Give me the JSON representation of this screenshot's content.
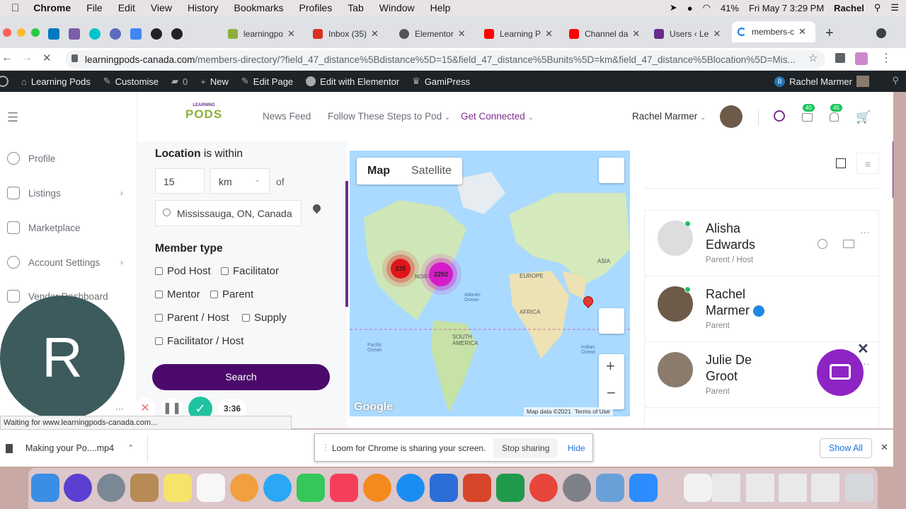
{
  "menubar": {
    "app": "Chrome",
    "items": [
      "File",
      "Edit",
      "View",
      "History",
      "Bookmarks",
      "Profiles",
      "Tab",
      "Window",
      "Help"
    ],
    "battery": "41%",
    "datetime": "Fri May 7  3:29 PM",
    "user": "Rachel"
  },
  "tabs": [
    {
      "label": "learningpo",
      "color": "#8bb03a"
    },
    {
      "label": "Inbox (35)",
      "color": "#d93025"
    },
    {
      "label": "Elementor",
      "color": "#555"
    },
    {
      "label": "Learning P",
      "color": "#ff0000"
    },
    {
      "label": "Channel da",
      "color": "#ff0000"
    },
    {
      "label": "Users ‹ Le",
      "color": "#6a2c8e"
    },
    {
      "label": "members-c",
      "color": "#1a73e8"
    }
  ],
  "address": {
    "host": "learningpods-canada.com",
    "path": "/members-directory/?field_47_distance%5Bdistance%5D=15&field_47_distance%5Bunits%5D=km&field_47_distance%5Blocation%5D=Mis..."
  },
  "wpbar": {
    "site": "Learning Pods",
    "customise": "Customise",
    "comments": "0",
    "new": "New",
    "edit_page": "Edit Page",
    "edit_elementor": "Edit with Elementor",
    "gamipress": "GamiPress",
    "user": "Rachel Marmer"
  },
  "sidenav": {
    "items": [
      "Profile",
      "Listings",
      "Marketplace",
      "Account Settings",
      "Vendor Dashboard"
    ]
  },
  "header": {
    "logo_top": "LEARNING",
    "logo_main": "PODS",
    "nav": [
      "News Feed",
      "Follow These Steps to Pod",
      "Get Connected"
    ],
    "user": "Rachel Marmer",
    "messages_badge": "40",
    "notifications_badge": "45"
  },
  "filters": {
    "location_label": "Location",
    "within_label": "is within",
    "distance": "15",
    "units": "km",
    "of_label": "of",
    "location_value": "Mississauga, ON, Canada",
    "member_type_label": "Member type",
    "types": [
      "Pod Host",
      "Facilitator",
      "Mentor",
      "Parent",
      "Parent / Host",
      "Supply",
      "Facilitator / Host"
    ],
    "search_button": "Search"
  },
  "map": {
    "tab_map": "Map",
    "tab_satellite": "Satellite",
    "cluster1": "235",
    "cluster2": "2202",
    "labels": [
      "NORTH",
      "ASIA",
      "EUROPE",
      "AFRICA",
      "Atlantic Ocean",
      "SOUTH AMERICA",
      "Pacific Ocean",
      "Indian Ocean"
    ],
    "attribution": "Map data ©2021",
    "terms": "Terms of Use",
    "google": "Google"
  },
  "members": [
    {
      "first": "Alisha",
      "last": "Edwards",
      "role": "Parent / Host"
    },
    {
      "first": "Rachel",
      "last": "Marmer",
      "role": "Parent"
    },
    {
      "first": "Julie De",
      "last": "Groot",
      "role": "Parent"
    }
  ],
  "loom": {
    "avatar_letter": "R",
    "timer": "3:36"
  },
  "status": "Waiting for www.learningpods-canada.com...",
  "download": {
    "file": "Making your Po....mp4",
    "show_all": "Show All"
  },
  "sharebar": {
    "message": "Loom for Chrome is sharing your screen.",
    "stop": "Stop sharing",
    "hide": "Hide"
  }
}
